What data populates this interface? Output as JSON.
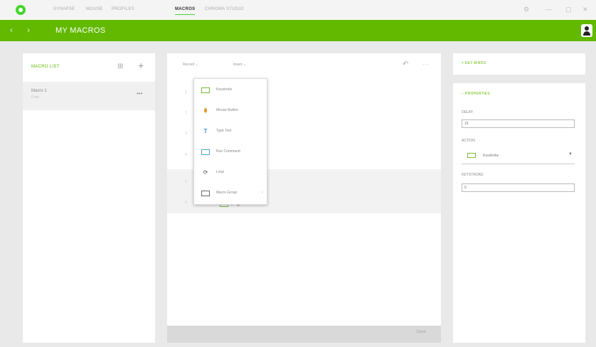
{
  "nav": {
    "tabs": [
      "Synapse",
      "Mouse",
      "Profiles",
      "Macros",
      "Chroma Studio"
    ],
    "active_tab": "Macros"
  },
  "window": {
    "settings_icon": "gear-icon",
    "minimize": "—",
    "maximize": "▢",
    "close": "✕"
  },
  "header": {
    "back": "‹",
    "forward": "›",
    "title": "MY MACROS"
  },
  "macro_list": {
    "title": "MACRO LIST",
    "items": [
      {
        "name": "Macro 1",
        "sub": "0 ms"
      }
    ],
    "more": "•••"
  },
  "editor": {
    "record_label": "Record  ⌄",
    "insert_label": "Insert  ⌄",
    "gutter": [
      "1",
      "2",
      "3",
      "4",
      "5",
      "6"
    ],
    "strip_add": "+",
    "strip_caret": "⌄"
  },
  "insert_menu": {
    "items": [
      {
        "label": "Keystroke",
        "icon": "keyboard-icon"
      },
      {
        "label": "Mouse Button",
        "icon": "mouse-icon"
      },
      {
        "label": "Type Text",
        "icon": "text-icon"
      },
      {
        "label": "Run Command",
        "icon": "command-icon"
      },
      {
        "label": "Loop",
        "icon": "loop-icon"
      },
      {
        "label": "Macro Group",
        "icon": "macro-group-icon",
        "has_submenu": true
      }
    ],
    "submenu_caret": "›"
  },
  "footer": {
    "save": "Save"
  },
  "key_binds": {
    "title": "+ KEY BINDS"
  },
  "properties": {
    "title": "− PROPERTIES",
    "delay_label": "DELAY",
    "delay_value": "16",
    "action_label": "ACTION",
    "action_value": "Keystroke",
    "keystroke_label": "KEYSTROKE",
    "keystroke_value": "0"
  },
  "colors": {
    "accent": "#62b900",
    "logo": "#44d62c"
  }
}
